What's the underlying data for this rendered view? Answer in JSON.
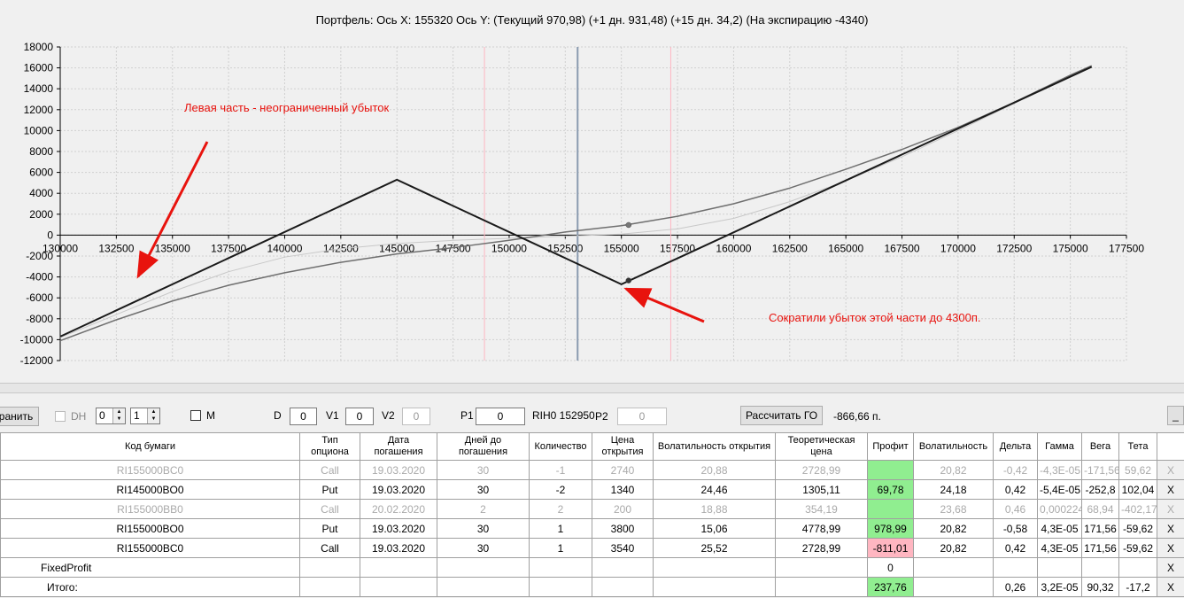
{
  "chart_data": {
    "type": "line",
    "title": "Портфель: Ось X:  155320 Ось Y:   (Текущий 970,98)  (+1 дн. 931,48)  (+15 дн. 34,2)  (На экспирацию -4340)",
    "x_ticks": [
      130000,
      132500,
      135000,
      137500,
      140000,
      142500,
      145000,
      147500,
      150000,
      152500,
      155000,
      157500,
      160000,
      162500,
      165000,
      167500,
      170000,
      172500,
      175000,
      177500
    ],
    "y_ticks": [
      18000,
      16000,
      14000,
      12000,
      10000,
      8000,
      6000,
      4000,
      2000,
      0,
      -2000,
      -4000,
      -6000,
      -8000,
      -10000,
      -12000
    ],
    "xlim": [
      130000,
      177500
    ],
    "ylim": [
      -12000,
      18000
    ],
    "grid": true,
    "vertical_lines": [
      {
        "x": 148900,
        "color": "#ffb6c1"
      },
      {
        "x": 153050,
        "color": "#8a9bb0"
      },
      {
        "x": 157200,
        "color": "#ffb6c1"
      }
    ],
    "series": [
      {
        "color": "#1a1a1a",
        "width": 2,
        "x": [
          130000,
          145000,
          155000,
          175950
        ],
        "y": [
          -9700,
          5300,
          -4700,
          16100
        ]
      },
      {
        "color": "#6f6f6f",
        "width": 1.5,
        "x": [
          130000,
          132500,
          135000,
          137500,
          140000,
          142500,
          145000,
          147500,
          150000,
          152500,
          155000,
          157500,
          160000,
          162500,
          165000,
          167500,
          170000,
          172500,
          175000,
          175950
        ],
        "y": [
          -10100,
          -8100,
          -6300,
          -4800,
          -3600,
          -2600,
          -1800,
          -1200,
          -500,
          300,
          900,
          1800,
          3000,
          4500,
          6300,
          8200,
          10300,
          12700,
          15300,
          16200
        ]
      },
      {
        "color": "#c8c8c8",
        "width": 1,
        "x": [
          130000,
          132500,
          135000,
          137500,
          140000,
          142500,
          145000,
          147500,
          150000,
          152500,
          155000,
          157500,
          160000,
          162500,
          165000,
          167500,
          170000,
          172500,
          175000,
          175950
        ],
        "y": [
          -9800,
          -7600,
          -5400,
          -3500,
          -2100,
          -1300,
          -800,
          -500,
          -300,
          -100,
          100,
          600,
          1600,
          3200,
          5200,
          7500,
          10000,
          12600,
          15200,
          16100
        ]
      }
    ],
    "markers": [
      {
        "x": 155320,
        "y": 970,
        "color": "#777777"
      },
      {
        "x": 155320,
        "y": -4340,
        "color": "#333333"
      }
    ],
    "annotations": [
      {
        "text": "Левая часть - неограниченный убыток",
        "color": "#e8130e"
      },
      {
        "text": "Сократили убыток этой части до 4300п.",
        "color": "#e8130e"
      }
    ]
  },
  "toolbar": {
    "save_label": "ранить",
    "dh_label": "DH",
    "spin1": "0",
    "spin2": "1",
    "m_label": "M",
    "d_label": "D",
    "d_value": "0",
    "v1_label": "V1",
    "v1_value": "0",
    "v2_label": "V2",
    "v2_value": "0",
    "p1_label": "P1",
    "p1_value": "0",
    "rih_label": "RIH0 152950",
    "p2_label": "P2",
    "p2_value": "0",
    "calc_label": "Рассчитать ГО",
    "calc_result": "-866,66 п.",
    "minimize_label": "_"
  },
  "table": {
    "headers": [
      "Код бумаги",
      "Тип опциона",
      "Дата погашения",
      "Дней до погашения",
      "Количество",
      "Цена открытия",
      "Волатильность открытия",
      "Теоретическая цена",
      "Профит",
      "Волатильность",
      "Дельта",
      "Гамма",
      "Вега",
      "Тета",
      ""
    ],
    "rows": [
      {
        "dim": true,
        "cells": [
          "RI155000BC0",
          "Call",
          "19.03.2020",
          "30",
          "-1",
          "2740",
          "20,88",
          "2728,99",
          "",
          "20,82",
          "-0,42",
          "-4,3E-05",
          "-171,56",
          "59,62",
          "X"
        ],
        "profit": "green"
      },
      {
        "dim": false,
        "cells": [
          "RI145000BO0",
          "Put",
          "19.03.2020",
          "30",
          "-2",
          "1340",
          "24,46",
          "1305,11",
          "69,78",
          "24,18",
          "0,42",
          "-5,4E-05",
          "-252,8",
          "102,04",
          "X"
        ],
        "profit": "green"
      },
      {
        "dim": true,
        "cells": [
          "RI155000BB0",
          "Call",
          "20.02.2020",
          "2",
          "2",
          "200",
          "18,88",
          "354,19",
          "",
          "23,68",
          "0,46",
          "0,000224",
          "68,94",
          "-402,17",
          "X"
        ],
        "profit": "green"
      },
      {
        "dim": false,
        "cells": [
          "RI155000BO0",
          "Put",
          "19.03.2020",
          "30",
          "1",
          "3800",
          "15,06",
          "4778,99",
          "978,99",
          "20,82",
          "-0,58",
          "4,3E-05",
          "171,56",
          "-59,62",
          "X"
        ],
        "profit": "green"
      },
      {
        "dim": false,
        "cells": [
          "RI155000BC0",
          "Call",
          "19.03.2020",
          "30",
          "1",
          "3540",
          "25,52",
          "2728,99",
          "-811,01",
          "20,82",
          "0,42",
          "4,3E-05",
          "171,56",
          "-59,62",
          "X"
        ],
        "profit": "red"
      },
      {
        "dim": false,
        "cells": [
          "FixedProfit",
          "",
          "",
          "",
          "",
          "",
          "",
          "",
          "0",
          "",
          "",
          "",
          "",
          "",
          "X"
        ],
        "profit": "none"
      },
      {
        "dim": false,
        "cells": [
          "Итого:",
          "",
          "",
          "",
          "",
          "",
          "",
          "",
          "237,76",
          "",
          "0,26",
          "3,2E-05",
          "90,32",
          "-17,2",
          "X"
        ],
        "profit": "green"
      }
    ]
  }
}
